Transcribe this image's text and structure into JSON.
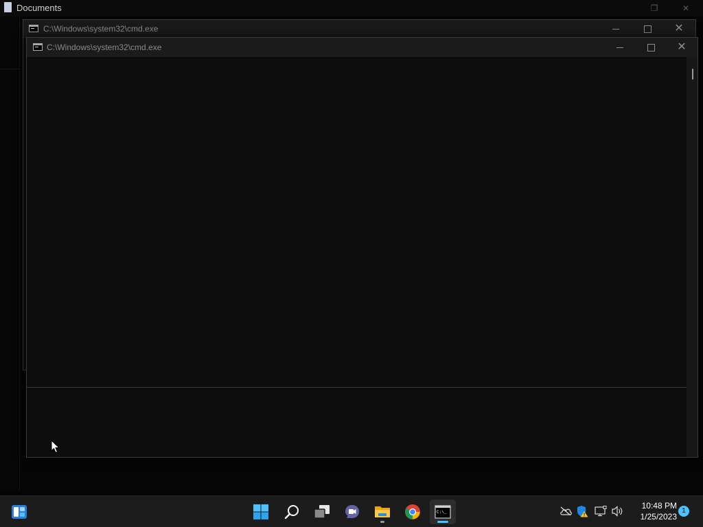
{
  "background_window": {
    "title": "Documents"
  },
  "cmd_window_back": {
    "title": "C:\\Windows\\system32\\cmd.exe"
  },
  "cmd_window_front": {
    "title": "C:\\Windows\\system32\\cmd.exe"
  },
  "taskbar": {
    "apps": [
      {
        "name": "widgets",
        "icon": "widgets-icon"
      },
      {
        "name": "start",
        "icon": "windows-start-icon"
      },
      {
        "name": "search",
        "icon": "search-icon"
      },
      {
        "name": "task-view",
        "icon": "task-view-icon"
      },
      {
        "name": "teams-chat",
        "icon": "chat-icon"
      },
      {
        "name": "file-explorer",
        "icon": "folder-icon"
      },
      {
        "name": "chrome",
        "icon": "chrome-icon"
      },
      {
        "name": "command-prompt",
        "icon": "terminal-icon"
      }
    ],
    "tray": [
      "onedrive-offline-icon",
      "security-warning-icon",
      "network-icon",
      "volume-icon"
    ],
    "clock": {
      "time": "10:48 PM",
      "date": "1/25/2023"
    },
    "notification_count": "1",
    "accent_color": "#4cc2ff"
  }
}
